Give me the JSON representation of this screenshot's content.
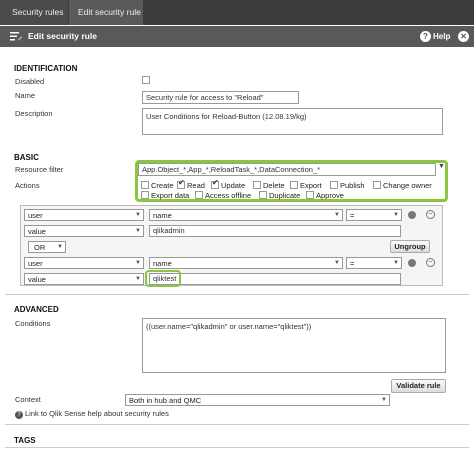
{
  "breadcrumbs": [
    "Security rules",
    "Edit security rule"
  ],
  "header": {
    "title": "Edit security rule",
    "help_label": "Help"
  },
  "identification": {
    "section": "IDENTIFICATION",
    "disabled_label": "Disabled",
    "name_label": "Name",
    "name_value": "Security rule for access to \"Reload\"",
    "description_label": "Description",
    "description_value": "User Conditions for Reload-Button (12.08.19/kg)"
  },
  "basic": {
    "section": "BASIC",
    "resource_filter_label": "Resource filter",
    "resource_filter_value": "App.Object_*,App_*,ReloadTask_*,DataConnection_*",
    "actions_label": "Actions",
    "actions": [
      {
        "label": "Create",
        "checked": false
      },
      {
        "label": "Read",
        "checked": true
      },
      {
        "label": "Update",
        "checked": true
      },
      {
        "label": "Delete",
        "checked": false
      },
      {
        "label": "Export",
        "checked": false
      },
      {
        "label": "Publish",
        "checked": false
      },
      {
        "label": "Change owner",
        "checked": false
      },
      {
        "label": "Export data",
        "checked": false
      },
      {
        "label": "Access offline",
        "checked": false
      },
      {
        "label": "Duplicate",
        "checked": false
      },
      {
        "label": "Approve",
        "checked": false
      }
    ]
  },
  "conditions": {
    "row1": {
      "type": "user",
      "prop": "name",
      "op": "="
    },
    "row1_value": {
      "type": "value",
      "text": "qlikadmin"
    },
    "logic": "OR",
    "ungroup_label": "Ungroup",
    "row2": {
      "type": "user",
      "prop": "name",
      "op": "="
    },
    "row2_value": {
      "type": "value",
      "text": "qliktest"
    }
  },
  "advanced": {
    "section": "ADVANCED",
    "conditions_label": "Conditions",
    "conditions_value": "((user.name=\"qlikadmin\" or user.name=\"qliktest\"))",
    "validate_label": "Validate rule",
    "context_label": "Context",
    "context_value": "Both in hub and QMC",
    "help_link": "Link to Qlik Sense help about security rules"
  },
  "tags": {
    "section": "TAGS"
  },
  "colors": {
    "highlight": "#8cc63f",
    "topbar": "#3c3c3c",
    "titlebar": "#595959"
  }
}
